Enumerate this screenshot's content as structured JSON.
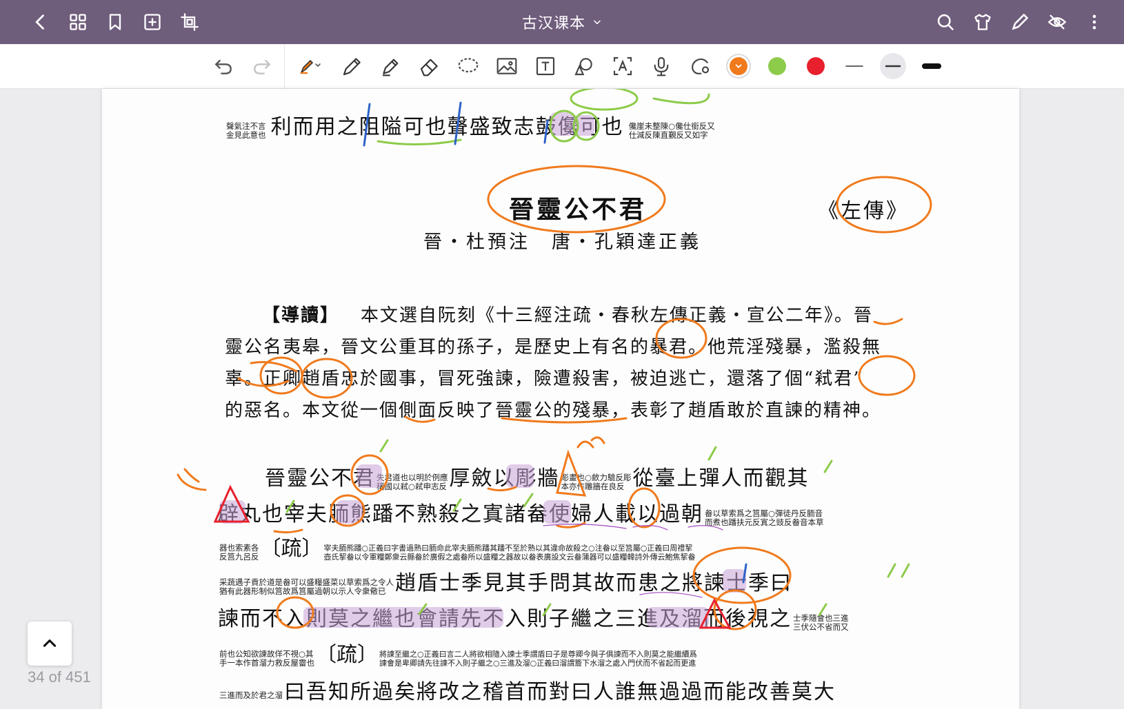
{
  "app": {
    "title": "古汉课本",
    "top_left_icons": [
      "back-icon",
      "grid-icon",
      "bookmark-icon",
      "add-page-icon",
      "crop-icon"
    ],
    "top_right_icons": [
      "search-icon",
      "shirt-icon",
      "pen-icon",
      "eye-off-icon",
      "more-icon"
    ]
  },
  "toolbar": {
    "tools": [
      "undo-icon",
      "redo-icon",
      "highlighter-icon",
      "pen-icon",
      "marker-icon",
      "eraser-icon",
      "lasso-icon",
      "image-icon",
      "text-icon",
      "shape-icon",
      "text-recognition-icon",
      "mic-icon",
      "laser-icon"
    ],
    "colors": [
      "#f07a1c",
      "#8dcb4a",
      "#e8202e"
    ],
    "selected_color": "#f07a1c",
    "stroke_widths": [
      "thin",
      "medium",
      "thick"
    ],
    "selected_stroke": "medium"
  },
  "page": {
    "top_line": {
      "note_a": "聲氣注不言\n金見此意也",
      "main": "利而用之阻隘可也聲盛致志鼓儳可也",
      "note_b": "儳崖未整陳○儳仕銜反又\n仕減反陳直覲反又如字"
    },
    "title": "晉靈公不君",
    "source": "《左傳》",
    "byline": "晉・杜預注　唐・孔穎達正義",
    "intro": {
      "label": "【導讀】",
      "lines": [
        "本文選自阮刻《十三經注疏・春秋左傳正義・宣公二年》。晉",
        "靈公名夷皋，晉文公重耳的孫子，是歷史上有名的暴君。他荒淫殘暴，濫殺無",
        "辜。正卿趙盾忠於國事，冒死強諫，險遭殺害，被迫逃亡，還落了個“弒君”",
        "的惡名。本文從一個側面反映了晉靈公的殘暴，表彰了趙盾敢於直諫的精神。"
      ]
    },
    "text_rows": [
      {
        "pre": "晉靈公不君",
        "n1": "失君道也以明於例應\n稱國以弒○弒申志反",
        "mid": "厚斂以彫牆",
        "n2": "彫畫也○斂力驗反彫\n本亦作雕牆在良反",
        "post": "從臺上彈人而觀其"
      },
      {
        "pre": "辟丸也宰夫胹熊蹯不熟殺之寘諸畚使婦人載以過朝",
        "n1": "畚以草索爲之筥屬○彈徒丹反胹音\n而煮也蹯扶元反寘之豉反畚音本草"
      },
      {
        "n0": "器也索素各\n反筥九呂反",
        "shu": "〔疏〕",
        "n1": "宰夫胹熊蹯○正義曰字書過熟曰胹命此宰夫胹熊蹯其蹯不至於熟以其違命故殺之○注畚以至筥屬○正義曰周禮挈\n壺氏挈畚以令軍糧鄭衆云縣畚於廣假之處畚所以盛糧之器故以畚表廣設文云畚蒲器可以盛糧韓詩外傳云鮑焦挈畚"
      },
      {
        "n0": "采蔬遇子貢於道是畚可以盛糧盛菜以草索爲之令人\n猶有此器形制似筥故爲筥屬過朝以示人令衆儆已",
        "post": "趙盾士季見其手問其故而患之將諫士季曰"
      },
      {
        "pre": "諫而不入則莫之繼也會請先不入則子繼之三進及溜而後視之",
        "n1": "士季隨會也三進\n三伏公不省而又"
      },
      {
        "n0": "前也公知欲諫故佯不視○其\n手一本作首溜力救反屋霤也",
        "shu": "〔疏〕",
        "n1": "將諫至繼之○正義曰言二人將欲相隨入諫士季謂盾曰子是尊卿今與子俱諫而不入則莫之能繼續爲\n諫會是卑卿請先往諫不入則子繼之○三進及溜○正義曰溜謂簷下水溜之處入門伏而不省起而更進"
      },
      {
        "n0": "三進而及於君之溜",
        "post": "曰吾知所過矣將改之稽首而對曰人誰無過過而能改善莫大"
      }
    ]
  },
  "nav": {
    "page_counter": "34 of 451"
  }
}
